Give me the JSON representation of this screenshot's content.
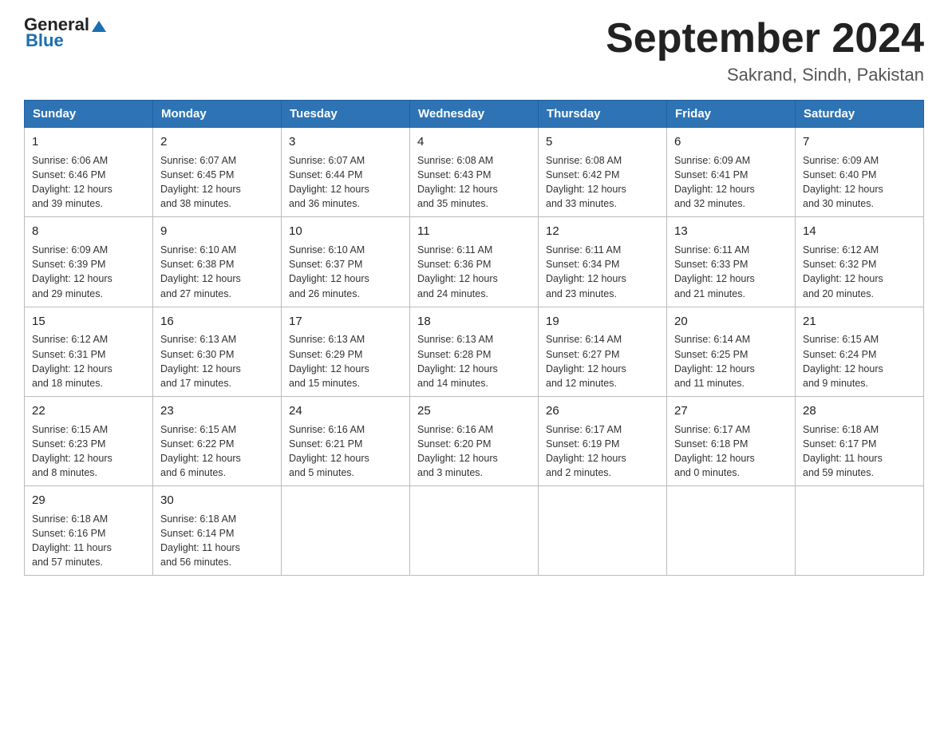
{
  "header": {
    "logo_general": "General",
    "logo_blue": "Blue",
    "month_year": "September 2024",
    "location": "Sakrand, Sindh, Pakistan"
  },
  "weekdays": [
    "Sunday",
    "Monday",
    "Tuesday",
    "Wednesday",
    "Thursday",
    "Friday",
    "Saturday"
  ],
  "weeks": [
    [
      {
        "day": "1",
        "sunrise": "6:06 AM",
        "sunset": "6:46 PM",
        "daylight": "12 hours and 39 minutes."
      },
      {
        "day": "2",
        "sunrise": "6:07 AM",
        "sunset": "6:45 PM",
        "daylight": "12 hours and 38 minutes."
      },
      {
        "day": "3",
        "sunrise": "6:07 AM",
        "sunset": "6:44 PM",
        "daylight": "12 hours and 36 minutes."
      },
      {
        "day": "4",
        "sunrise": "6:08 AM",
        "sunset": "6:43 PM",
        "daylight": "12 hours and 35 minutes."
      },
      {
        "day": "5",
        "sunrise": "6:08 AM",
        "sunset": "6:42 PM",
        "daylight": "12 hours and 33 minutes."
      },
      {
        "day": "6",
        "sunrise": "6:09 AM",
        "sunset": "6:41 PM",
        "daylight": "12 hours and 32 minutes."
      },
      {
        "day": "7",
        "sunrise": "6:09 AM",
        "sunset": "6:40 PM",
        "daylight": "12 hours and 30 minutes."
      }
    ],
    [
      {
        "day": "8",
        "sunrise": "6:09 AM",
        "sunset": "6:39 PM",
        "daylight": "12 hours and 29 minutes."
      },
      {
        "day": "9",
        "sunrise": "6:10 AM",
        "sunset": "6:38 PM",
        "daylight": "12 hours and 27 minutes."
      },
      {
        "day": "10",
        "sunrise": "6:10 AM",
        "sunset": "6:37 PM",
        "daylight": "12 hours and 26 minutes."
      },
      {
        "day": "11",
        "sunrise": "6:11 AM",
        "sunset": "6:36 PM",
        "daylight": "12 hours and 24 minutes."
      },
      {
        "day": "12",
        "sunrise": "6:11 AM",
        "sunset": "6:34 PM",
        "daylight": "12 hours and 23 minutes."
      },
      {
        "day": "13",
        "sunrise": "6:11 AM",
        "sunset": "6:33 PM",
        "daylight": "12 hours and 21 minutes."
      },
      {
        "day": "14",
        "sunrise": "6:12 AM",
        "sunset": "6:32 PM",
        "daylight": "12 hours and 20 minutes."
      }
    ],
    [
      {
        "day": "15",
        "sunrise": "6:12 AM",
        "sunset": "6:31 PM",
        "daylight": "12 hours and 18 minutes."
      },
      {
        "day": "16",
        "sunrise": "6:13 AM",
        "sunset": "6:30 PM",
        "daylight": "12 hours and 17 minutes."
      },
      {
        "day": "17",
        "sunrise": "6:13 AM",
        "sunset": "6:29 PM",
        "daylight": "12 hours and 15 minutes."
      },
      {
        "day": "18",
        "sunrise": "6:13 AM",
        "sunset": "6:28 PM",
        "daylight": "12 hours and 14 minutes."
      },
      {
        "day": "19",
        "sunrise": "6:14 AM",
        "sunset": "6:27 PM",
        "daylight": "12 hours and 12 minutes."
      },
      {
        "day": "20",
        "sunrise": "6:14 AM",
        "sunset": "6:25 PM",
        "daylight": "12 hours and 11 minutes."
      },
      {
        "day": "21",
        "sunrise": "6:15 AM",
        "sunset": "6:24 PM",
        "daylight": "12 hours and 9 minutes."
      }
    ],
    [
      {
        "day": "22",
        "sunrise": "6:15 AM",
        "sunset": "6:23 PM",
        "daylight": "12 hours and 8 minutes."
      },
      {
        "day": "23",
        "sunrise": "6:15 AM",
        "sunset": "6:22 PM",
        "daylight": "12 hours and 6 minutes."
      },
      {
        "day": "24",
        "sunrise": "6:16 AM",
        "sunset": "6:21 PM",
        "daylight": "12 hours and 5 minutes."
      },
      {
        "day": "25",
        "sunrise": "6:16 AM",
        "sunset": "6:20 PM",
        "daylight": "12 hours and 3 minutes."
      },
      {
        "day": "26",
        "sunrise": "6:17 AM",
        "sunset": "6:19 PM",
        "daylight": "12 hours and 2 minutes."
      },
      {
        "day": "27",
        "sunrise": "6:17 AM",
        "sunset": "6:18 PM",
        "daylight": "12 hours and 0 minutes."
      },
      {
        "day": "28",
        "sunrise": "6:18 AM",
        "sunset": "6:17 PM",
        "daylight": "11 hours and 59 minutes."
      }
    ],
    [
      {
        "day": "29",
        "sunrise": "6:18 AM",
        "sunset": "6:16 PM",
        "daylight": "11 hours and 57 minutes."
      },
      {
        "day": "30",
        "sunrise": "6:18 AM",
        "sunset": "6:14 PM",
        "daylight": "11 hours and 56 minutes."
      },
      null,
      null,
      null,
      null,
      null
    ]
  ],
  "labels": {
    "sunrise": "Sunrise:",
    "sunset": "Sunset:",
    "daylight": "Daylight:"
  }
}
